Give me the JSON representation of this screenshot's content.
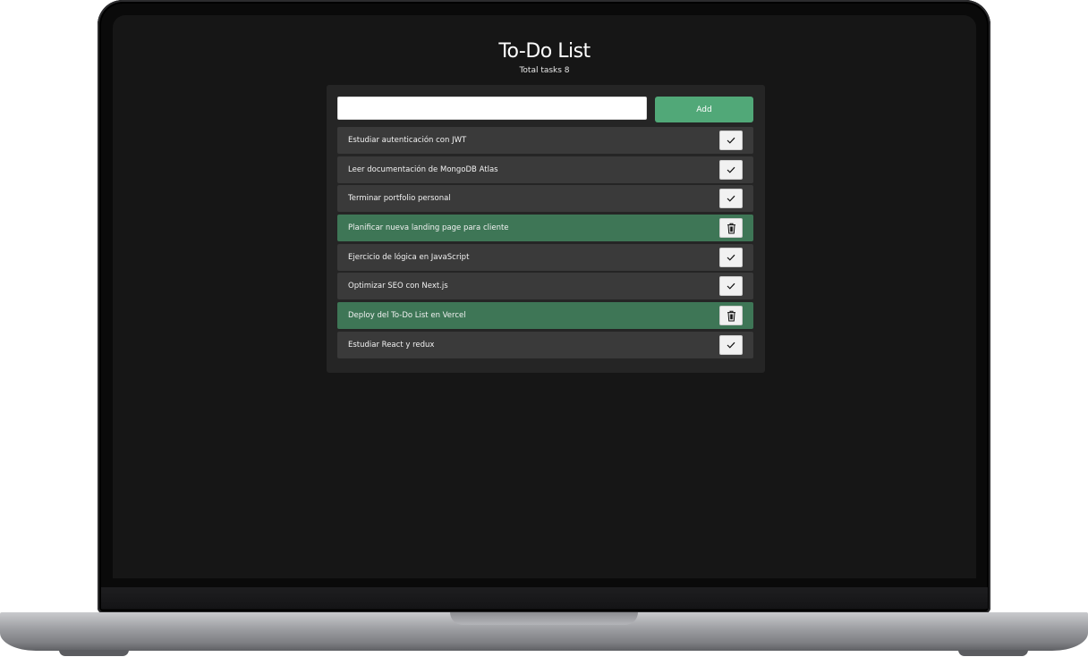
{
  "app": {
    "title": "To-Do List",
    "subtitle": "Total tasks 8"
  },
  "form": {
    "input_value": "",
    "input_placeholder": "",
    "add_label": "Add"
  },
  "colors": {
    "accent": "#51a878",
    "completed_row": "#3e7656",
    "row": "#3a3a3a",
    "background": "#161616"
  },
  "tasks": [
    {
      "text": "Estudiar autenticación con JWT",
      "completed": false,
      "action_icon": "check-icon"
    },
    {
      "text": "Leer documentación de MongoDB Atlas",
      "completed": false,
      "action_icon": "check-icon"
    },
    {
      "text": "Terminar portfolio personal",
      "completed": false,
      "action_icon": "check-icon"
    },
    {
      "text": "Planificar nueva landing page para cliente",
      "completed": true,
      "action_icon": "trash-icon"
    },
    {
      "text": "Ejercicio de lógica en JavaScript",
      "completed": false,
      "action_icon": "check-icon"
    },
    {
      "text": "Optimizar SEO con Next.js",
      "completed": false,
      "action_icon": "check-icon"
    },
    {
      "text": "Deploy del To-Do List en Vercel",
      "completed": true,
      "action_icon": "trash-icon"
    },
    {
      "text": "Estudiar React y redux",
      "completed": false,
      "action_icon": "check-icon"
    }
  ]
}
